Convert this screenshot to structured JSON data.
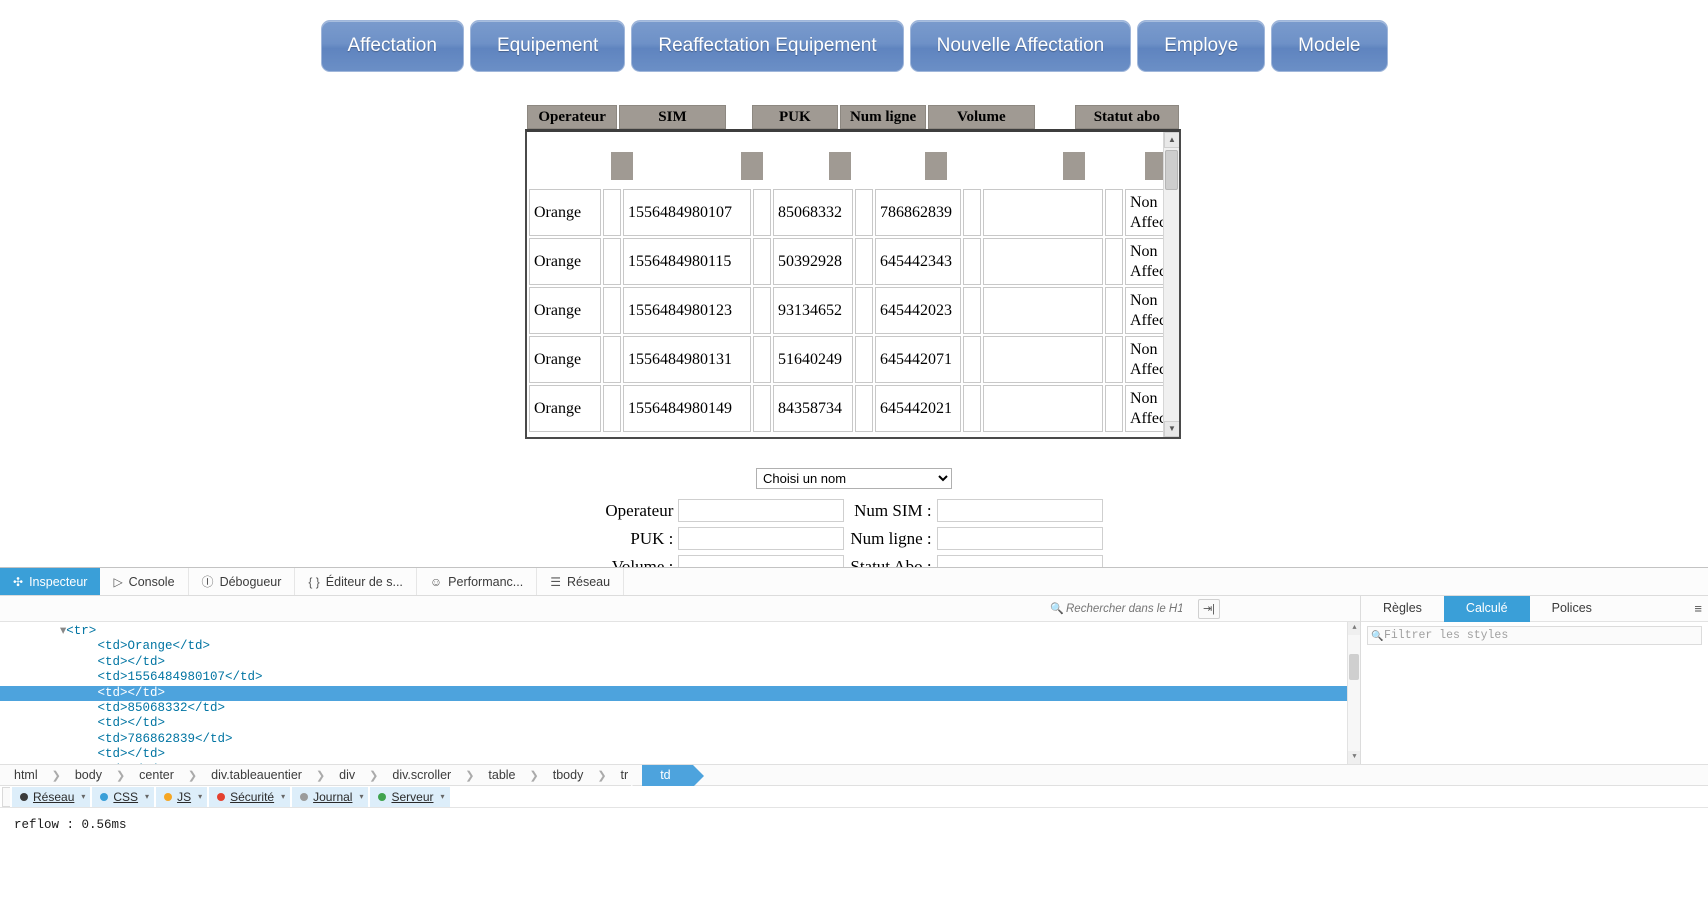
{
  "nav": {
    "buttons": [
      {
        "label": "Affectation"
      },
      {
        "label": "Equipement"
      },
      {
        "label": "Reaffectation Equipement"
      },
      {
        "label": "Nouvelle Affectation"
      },
      {
        "label": "Employe"
      },
      {
        "label": "Modele"
      }
    ]
  },
  "table": {
    "headers": [
      "Operateur",
      "SIM",
      "PUK",
      "Num ligne",
      "Volume",
      "Statut abo"
    ],
    "rows": [
      {
        "operateur": "Orange",
        "sim": "1556484980107",
        "puk": "85068332",
        "num_ligne": "786862839",
        "volume": "",
        "statut": "Non Affect�"
      },
      {
        "operateur": "Orange",
        "sim": "1556484980115",
        "puk": "50392928",
        "num_ligne": "645442343",
        "volume": "",
        "statut": "Non Affect�"
      },
      {
        "operateur": "Orange",
        "sim": "1556484980123",
        "puk": "93134652",
        "num_ligne": "645442023",
        "volume": "",
        "statut": "Non Affect�"
      },
      {
        "operateur": "Orange",
        "sim": "1556484980131",
        "puk": "51640249",
        "num_ligne": "645442071",
        "volume": "",
        "statut": "Non Affect�"
      },
      {
        "operateur": "Orange",
        "sim": "1556484980149",
        "puk": "84358734",
        "num_ligne": "645442021",
        "volume": "",
        "statut": "Non Affect�"
      }
    ]
  },
  "form": {
    "select_value": "Choisi un nom",
    "fields": {
      "operateur_label": "Operateur",
      "operateur_value": "",
      "num_sim_label": "Num SIM :",
      "num_sim_value": "",
      "puk_label": "PUK :",
      "puk_value": "",
      "num_ligne_label": "Num ligne :",
      "num_ligne_value": "",
      "volume_label": "Volume :",
      "volume_value": "",
      "statut_abo_label": "Statut Abo :",
      "statut_abo_value": ""
    }
  },
  "devtools": {
    "tabs": [
      {
        "label": "Inspecteur",
        "icon": "inspector-icon",
        "glyph": "✣",
        "active": true
      },
      {
        "label": "Console",
        "icon": "console-icon",
        "glyph": "▷",
        "active": false
      },
      {
        "label": "Débogueur",
        "icon": "debugger-icon",
        "glyph": "Ⓘ",
        "active": false
      },
      {
        "label": "Éditeur de s...",
        "icon": "style-editor-icon",
        "glyph": "{ }",
        "active": false
      },
      {
        "label": "Performanc...",
        "icon": "performance-icon",
        "glyph": "☺",
        "active": false
      },
      {
        "label": "Réseau",
        "icon": "network-icon",
        "glyph": "☰",
        "active": false
      }
    ],
    "dom_search_placeholder": "Rechercher dans le H1",
    "right_tabs": [
      {
        "label": "Règles",
        "active": false
      },
      {
        "label": "Calculé",
        "active": true
      },
      {
        "label": "Polices",
        "active": false
      }
    ],
    "rules_filter_placeholder": "Filtrer les styles",
    "dom_lines": [
      {
        "indent": 4,
        "content": "<tr>",
        "twisty": true,
        "selected": false
      },
      {
        "indent": 6,
        "content": "<td>Orange</td>",
        "twisty": false,
        "selected": false
      },
      {
        "indent": 6,
        "content": "<td></td>",
        "twisty": false,
        "selected": false
      },
      {
        "indent": 6,
        "content": "<td>1556484980107</td>",
        "twisty": false,
        "selected": false
      },
      {
        "indent": 6,
        "content": "<td></td>",
        "twisty": false,
        "selected": true
      },
      {
        "indent": 6,
        "content": "<td>85068332</td>",
        "twisty": false,
        "selected": false
      },
      {
        "indent": 6,
        "content": "<td></td>",
        "twisty": false,
        "selected": false
      },
      {
        "indent": 6,
        "content": "<td>786862839</td>",
        "twisty": false,
        "selected": false
      },
      {
        "indent": 6,
        "content": "<td></td>",
        "twisty": false,
        "selected": false
      },
      {
        "indent": 6,
        "content": "<td></td>",
        "twisty": false,
        "selected": false
      }
    ],
    "breadcrumb": [
      {
        "label": "html",
        "active": false
      },
      {
        "label": "body",
        "active": false
      },
      {
        "label": "center",
        "active": false
      },
      {
        "label": "div.tableauentier",
        "active": false
      },
      {
        "label": "div",
        "active": false
      },
      {
        "label": "div.scroller",
        "active": false
      },
      {
        "label": "table",
        "active": false
      },
      {
        "label": "tbody",
        "active": false
      },
      {
        "label": "tr",
        "active": false
      },
      {
        "label": "td",
        "active": true
      }
    ],
    "console_filters": [
      {
        "label": "Réseau",
        "color": "#3b3b3b"
      },
      {
        "label": "CSS",
        "color": "#3a9fd8"
      },
      {
        "label": "JS",
        "color": "#f5a623"
      },
      {
        "label": "Sécurité",
        "color": "#e4412f"
      },
      {
        "label": "Journal",
        "color": "#9b9b9b"
      },
      {
        "label": "Serveur",
        "color": "#3fa34d"
      }
    ],
    "console_output": "reflow : 0.56ms"
  },
  "colors": {
    "nav_button": "#6b8fc6",
    "table_header": "#a09a93",
    "devtools_accent": "#3a9fd8",
    "selection": "#4da3dd"
  }
}
